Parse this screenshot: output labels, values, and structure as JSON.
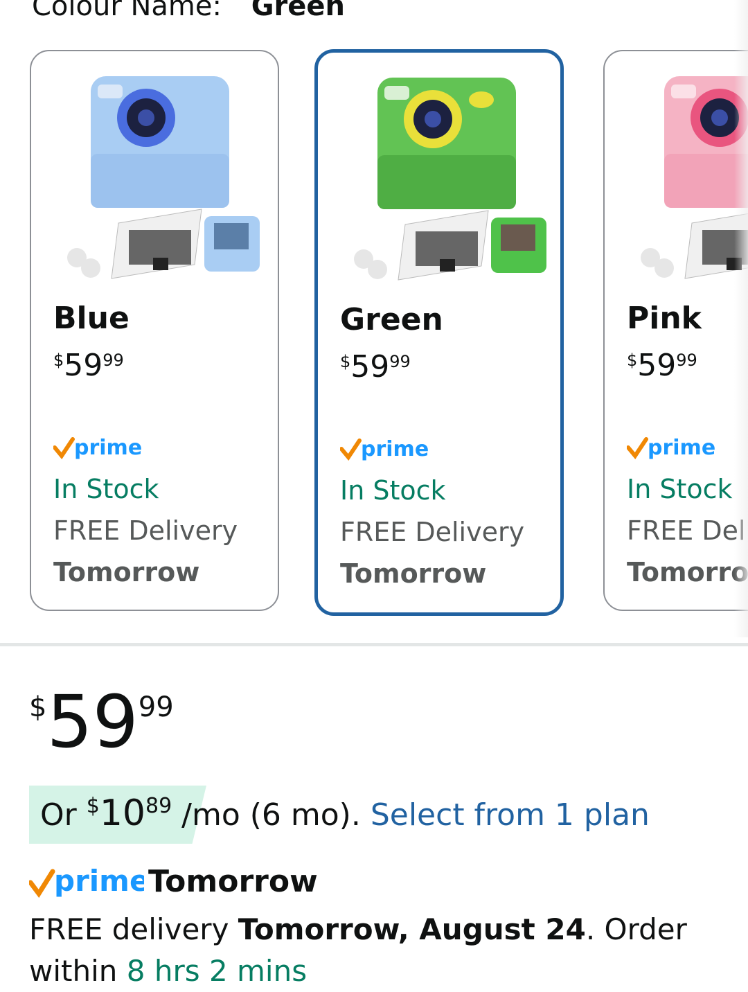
{
  "colour": {
    "label": "Colour Name:",
    "value": "Green"
  },
  "swatches": [
    {
      "name": "Blue",
      "price": {
        "currency": "$",
        "whole": "59",
        "fraction": "99"
      },
      "prime": "prime",
      "stock": "In Stock",
      "delivery": "FREE Delivery",
      "delivery_day": "Tomorrow",
      "body_color": "#a9cdf3",
      "lens_ring": "#4a6ddf",
      "selected": false
    },
    {
      "name": "Green",
      "price": {
        "currency": "$",
        "whole": "59",
        "fraction": "99"
      },
      "prime": "prime",
      "stock": "In Stock",
      "delivery": "FREE Delivery",
      "delivery_day": "Tomorrow",
      "body_color": "#62c354",
      "lens_ring": "#e9e03a",
      "selected": true
    },
    {
      "name": "Pink",
      "price": {
        "currency": "$",
        "whole": "59",
        "fraction": "99"
      },
      "prime": "prime",
      "stock": "In Stock",
      "delivery": "FREE Deli",
      "delivery_day": "Tomorro",
      "body_color": "#f5b3c4",
      "lens_ring": "#e9557f",
      "selected": false
    }
  ],
  "main_price": {
    "currency": "$",
    "whole": "59",
    "fraction": "99"
  },
  "installment": {
    "prefix": "Or ",
    "currency": "$",
    "whole": "10",
    "fraction": "89",
    "term": " /mo (6 mo). ",
    "link": "Select from 1 plan"
  },
  "prime_delivery": {
    "badge": "prime",
    "day": "Tomorrow"
  },
  "delivery_message": {
    "text1": "FREE delivery ",
    "date": "Tomorrow, August 24",
    "text2": ". Order within ",
    "countdown": "8 hrs 2 mins"
  },
  "colors": {
    "link": "#2162a1",
    "stock_green": "#067d62",
    "selected_border": "#2162a1",
    "prime_blue": "#1a98ff",
    "prime_check": "#f08804"
  }
}
